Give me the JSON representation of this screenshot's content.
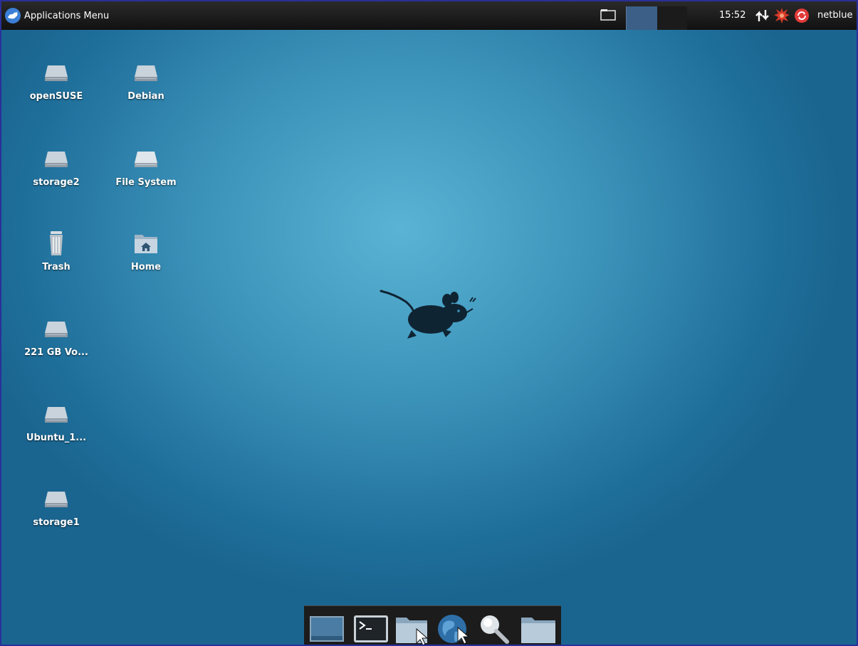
{
  "top_panel": {
    "app_menu_label": "Applications Menu",
    "clock": "15:52",
    "username": "netblue"
  },
  "desktop_icons": [
    {
      "label": "openSUSE",
      "icon": "drive-icon"
    },
    {
      "label": "Debian",
      "icon": "drive-icon"
    },
    {
      "label": "storage2",
      "icon": "drive-icon"
    },
    {
      "label": "File System",
      "icon": "drive-icon"
    },
    {
      "label": "Trash",
      "icon": "trash-icon"
    },
    {
      "label": "Home",
      "icon": "home-folder-icon"
    },
    {
      "label": "221 GB Vo...",
      "icon": "drive-icon"
    },
    {
      "label": "Ubuntu_1...",
      "icon": "drive-icon"
    },
    {
      "label": "storage1",
      "icon": "drive-icon"
    }
  ],
  "dock_items": [
    {
      "icon": "show-desktop-icon"
    },
    {
      "icon": "terminal-icon"
    },
    {
      "icon": "file-manager-icon"
    },
    {
      "icon": "web-browser-icon"
    },
    {
      "icon": "search-icon"
    },
    {
      "icon": "folder-icon"
    }
  ],
  "colors": {
    "desktop_center": "#5ab3d4",
    "desktop_edge": "#1a6590",
    "panel": "#1a1a1a",
    "workspace_active": "#3b5f87",
    "notification_red": "#d83a2a"
  }
}
